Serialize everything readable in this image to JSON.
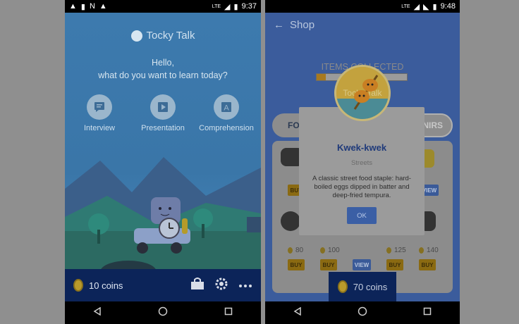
{
  "left": {
    "status": {
      "time": "9:37",
      "signal": "LTE"
    },
    "app_title": "Tocky Talk",
    "greeting_line1": "Hello,",
    "greeting_line2": "what do you want to learn today?",
    "options": [
      {
        "label": "Interview",
        "icon": "chat-bubble-icon"
      },
      {
        "label": "Presentation",
        "icon": "play-icon"
      },
      {
        "label": "Comprehension",
        "icon": "letter-a-icon"
      }
    ],
    "coins_label": "10 coins",
    "icons": [
      "shop-icon",
      "gear-icon",
      "more-dots-icon"
    ]
  },
  "right": {
    "status": {
      "time": "9:48",
      "signal": "LTE"
    },
    "header_title": "Shop",
    "items_collected_label": "ITEMS COLLECTED",
    "items_collected_progress": 0.1,
    "tab_left": "FO",
    "tab_right": "NIRS",
    "prices": [
      "80",
      "100",
      "125",
      "140"
    ],
    "buy_label": "BUY",
    "view_label": "VIEW",
    "dialog": {
      "badge_text": "Tocky Talk",
      "title": "Kwek-kwek",
      "subtitle": "Streets",
      "description": "A classic street food staple: hard-boiled eggs dipped in batter and deep-fried tempura.",
      "ok_label": "OK"
    },
    "coins_label": "70 coins"
  },
  "colors": {
    "accent": "#0c2459",
    "dim_overlay": "#8f8f8f"
  }
}
